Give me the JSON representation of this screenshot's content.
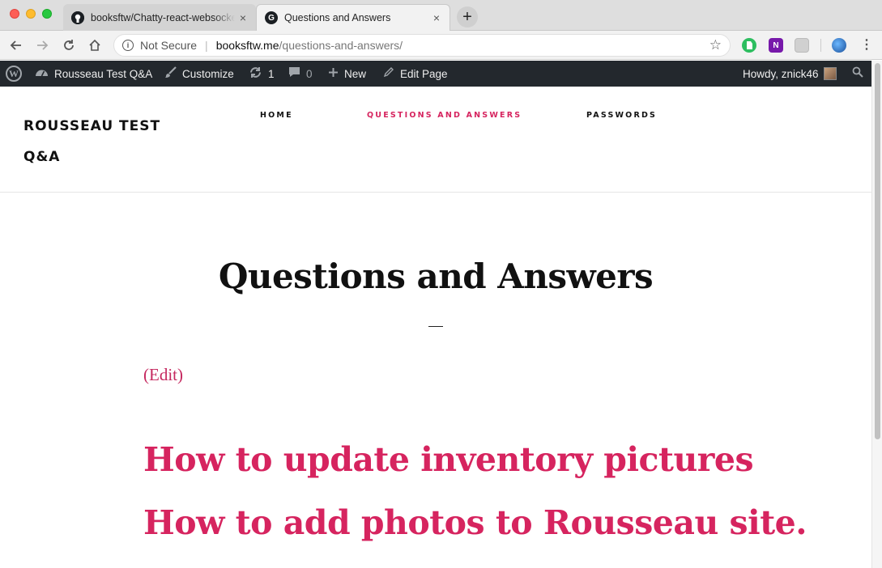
{
  "browser": {
    "tabs": [
      {
        "title": "booksftw/Chatty-react-websocket",
        "favicon": "github-icon",
        "close": "×"
      },
      {
        "title": "Questions and Answers",
        "favicon": "g-icon",
        "favicon_glyph": "G",
        "close": "×"
      }
    ],
    "new_tab": "+",
    "address": {
      "security_label": "Not Secure",
      "host": "booksftw.me",
      "path": "/questions-and-answers/"
    }
  },
  "admin_bar": {
    "site_name": "Rousseau Test Q&A",
    "customize": "Customize",
    "updates_count": "1",
    "comments_count": "0",
    "new_label": "New",
    "edit_page": "Edit Page",
    "howdy": "Howdy, znick46"
  },
  "site": {
    "title_line1": "ROUSSEAU TEST",
    "title_line2": "Q&A",
    "nav": [
      {
        "label": "HOME"
      },
      {
        "label": "QUESTIONS AND ANSWERS",
        "current": true
      },
      {
        "label": "PASSWORDS"
      }
    ]
  },
  "page": {
    "title": "Questions and Answers",
    "edit_link": "(Edit)",
    "links": [
      {
        "label": "How to update inventory pictures"
      },
      {
        "label": "How to add photos to Rousseau site."
      }
    ]
  },
  "colors": {
    "accent": "#d6245f",
    "admin_bar_bg": "#23282d"
  }
}
